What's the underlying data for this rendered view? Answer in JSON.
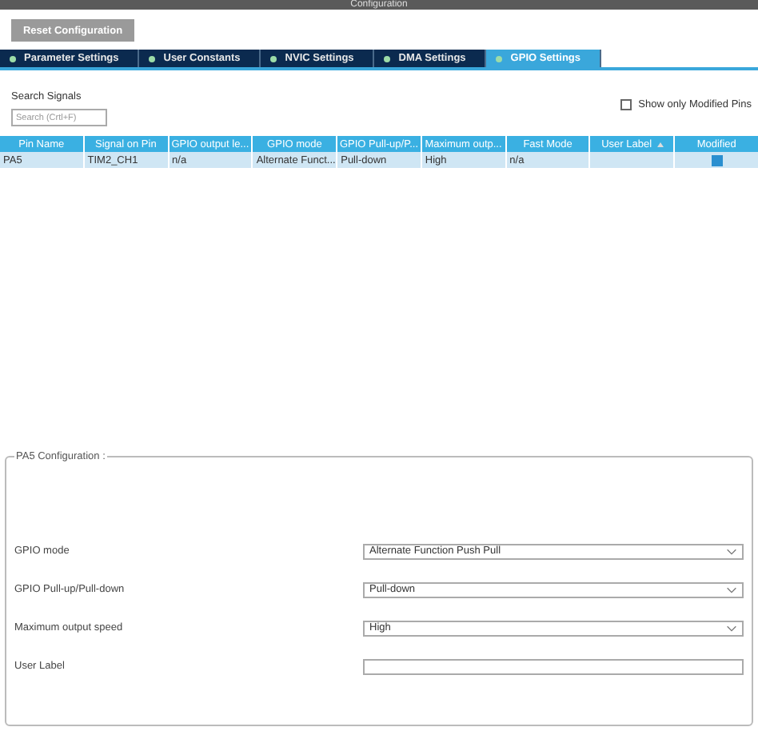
{
  "window": {
    "title": "Configuration"
  },
  "reset_button": "Reset Configuration",
  "tabs": [
    {
      "label": "Parameter Settings",
      "selected": false
    },
    {
      "label": "User Constants",
      "selected": false
    },
    {
      "label": "NVIC Settings",
      "selected": false
    },
    {
      "label": "DMA Settings",
      "selected": false
    },
    {
      "label": "GPIO Settings",
      "selected": true
    }
  ],
  "search": {
    "label": "Search Signals",
    "placeholder": "Search (Crtl+F)"
  },
  "show_only_modified": {
    "label": "Show only Modified Pins",
    "checked": false
  },
  "table": {
    "columns": [
      {
        "label": "Pin Name",
        "sorted": false
      },
      {
        "label": "Signal on Pin",
        "sorted": false
      },
      {
        "label": "GPIO output le...",
        "sorted": false
      },
      {
        "label": "GPIO mode",
        "sorted": false
      },
      {
        "label": "GPIO Pull-up/P...",
        "sorted": false
      },
      {
        "label": "Maximum outp...",
        "sorted": false
      },
      {
        "label": "Fast Mode",
        "sorted": false
      },
      {
        "label": "User Label",
        "sorted": true
      },
      {
        "label": "Modified",
        "sorted": false
      }
    ],
    "rows": [
      {
        "selected": true,
        "cells": [
          "PA5",
          "TIM2_CH1",
          "n/a",
          "Alternate Funct...",
          "Pull-down",
          "High",
          "n/a",
          null
        ],
        "modified": true
      }
    ]
  },
  "config": {
    "title": "PA5 Configuration :",
    "fields": [
      {
        "kind": "select",
        "label": "GPIO mode",
        "value": "Alternate Function Push Pull"
      },
      {
        "kind": "select",
        "label": "GPIO Pull-up/Pull-down",
        "value": "Pull-down"
      },
      {
        "kind": "select",
        "label": "Maximum output speed",
        "value": "High"
      },
      {
        "kind": "text",
        "label": "User Label"
      }
    ]
  }
}
